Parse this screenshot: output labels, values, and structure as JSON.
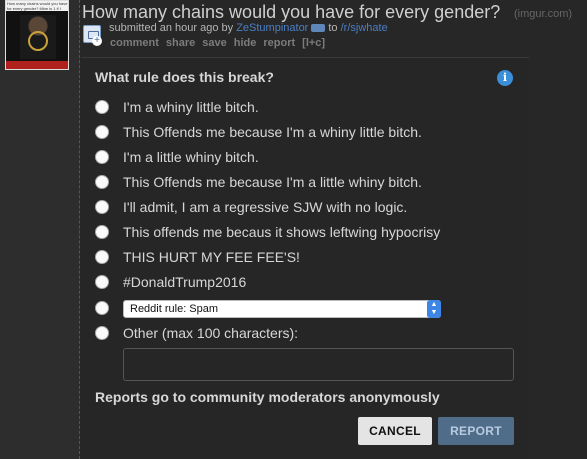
{
  "post": {
    "title": "How many chains would you have for every gender?",
    "domain": "(imgur.com)",
    "submitted_prefix": "submitted an hour ago by",
    "author": "ZeStumpinator",
    "to_text": "to",
    "subreddit": "/r/sjwhate",
    "thumbnail_caption": "How many chains would you have for every gender? Mine is 1 if I have",
    "actions": [
      "comment",
      "share",
      "save",
      "hide",
      "report",
      "[l+c]"
    ]
  },
  "report_dialog": {
    "title": "What rule does this break?",
    "options": [
      "I'm a whiny little bitch.",
      "This Offends me because I'm a whiny little bitch.",
      "I'm a little whiny bitch.",
      "This Offends me because I'm a little whiny bitch.",
      "I'll admit, I am a regressive SJW with no logic.",
      "This offends me becaus it shows leftwing hypocrisy",
      "THIS HURT MY FEE FEE'S!",
      "#DonaldTrump2016"
    ],
    "reddit_rule_select": "Reddit rule: Spam",
    "other_label": "Other (max 100 characters):",
    "other_value": "",
    "footnote": "Reports go to community moderators anonymously",
    "cancel_label": "CANCEL",
    "report_label": "REPORT"
  },
  "colors": {
    "background": "#272727",
    "link_blue": "#4c7ec5",
    "info_blue": "#3b8fd8",
    "report_button": "#4f6d88"
  }
}
